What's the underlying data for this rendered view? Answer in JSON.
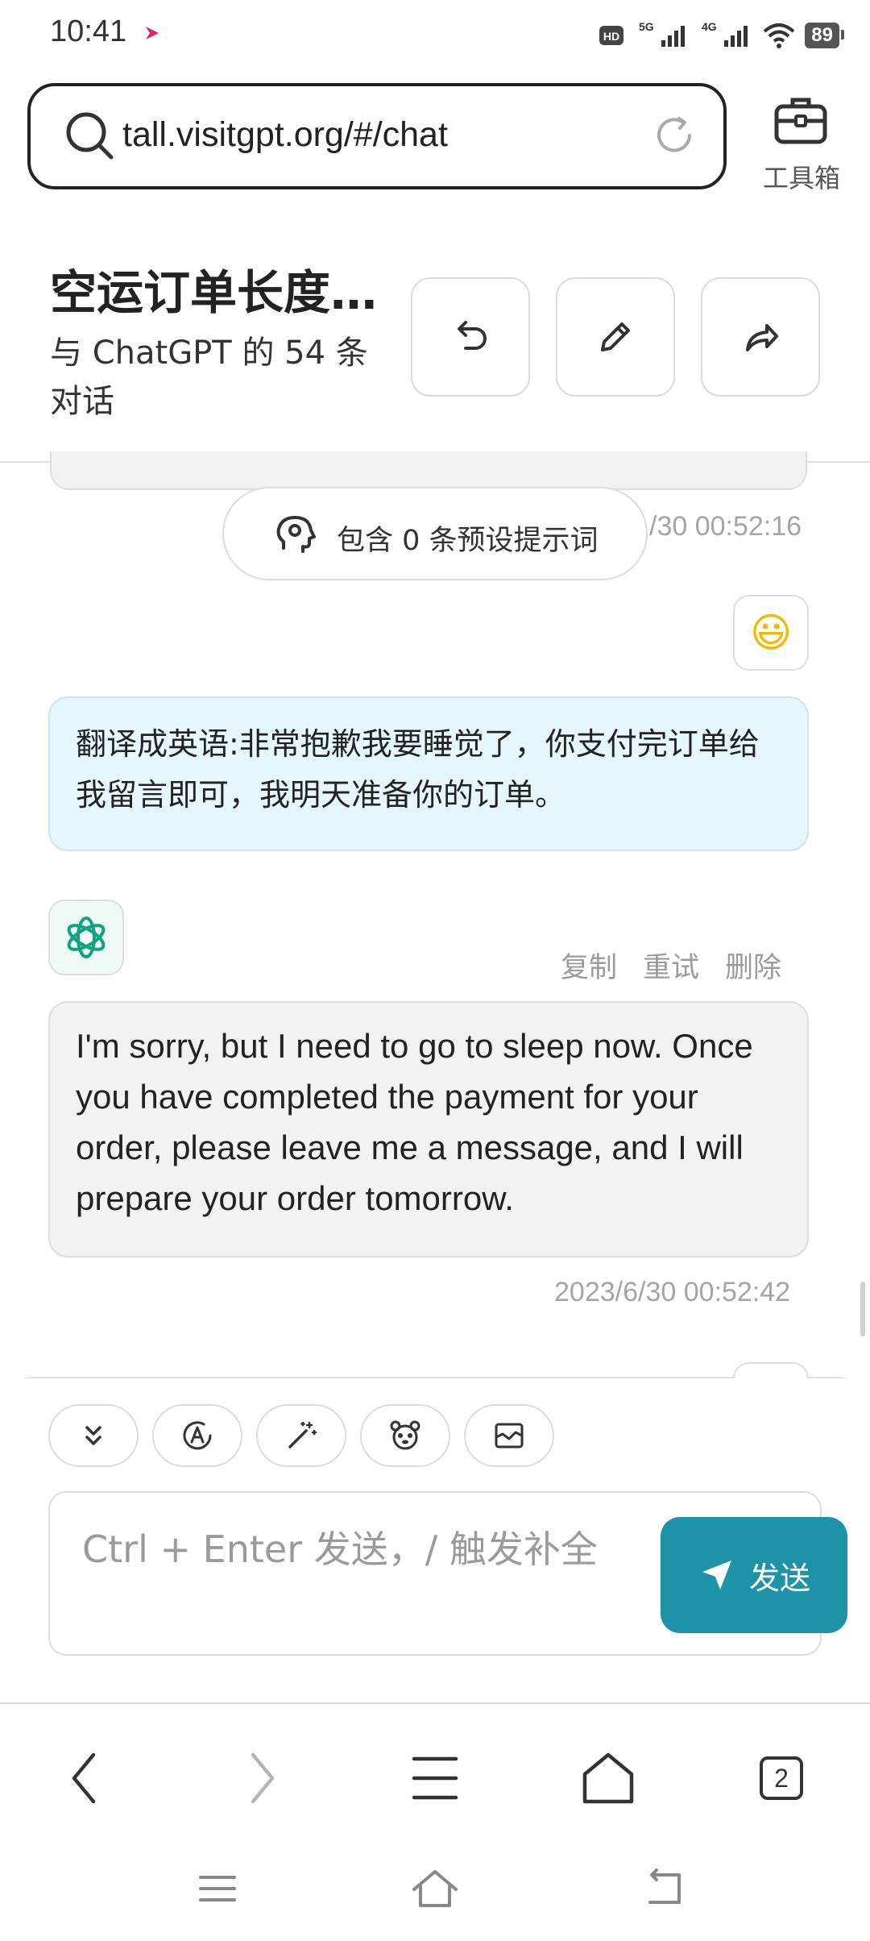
{
  "status_bar": {
    "time": "10:41",
    "icons": [
      "hd-icon",
      "5g-signal-icon",
      "4g-signal-icon",
      "wifi-icon"
    ],
    "network_labels": [
      "5G",
      "4G"
    ],
    "battery": "89"
  },
  "browser": {
    "url": "tall.visitgpt.org/#/chat",
    "toolbox_label": "工具箱"
  },
  "chat_header": {
    "title": "空运订单长度…",
    "subtitle": "与 ChatGPT 的 54 条对话"
  },
  "messages": {
    "prompt_pill": "包含 0 条预设提示词",
    "prev_timestamp": "/30 00:52:16",
    "user_avatar": "😃",
    "user_message": "翻译成英语:非常抱歉我要睡觉了，你支付完订单给我留言即可，我明天准备你的订单。",
    "bot_actions": {
      "copy": "复制",
      "retry": "重试",
      "delete": "删除"
    },
    "bot_message": "I'm sorry, but I need to go to sleep now. Once you have completed the payment for your order, please leave me a message, and I will prepare your order tomorrow.",
    "bot_timestamp": "2023/6/30 00:52:42"
  },
  "composer": {
    "placeholder": "Ctrl + Enter 发送，/ 触发补全",
    "send_label": "发送",
    "tools": [
      "scroll-down-icon",
      "model-icon",
      "magic-wand-icon",
      "mask-icon",
      "clear-context-icon"
    ]
  },
  "browser_nav": {
    "tab_count": "2"
  },
  "colors": {
    "accent": "#1d93a8",
    "user_bubble": "#e6f6fd",
    "bot_bubble": "#f2f2f2"
  }
}
